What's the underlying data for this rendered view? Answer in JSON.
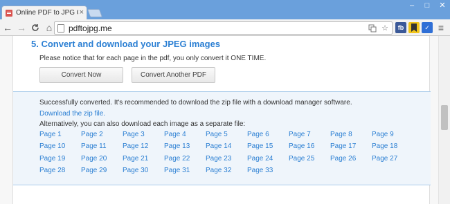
{
  "browser": {
    "tab_title": "Online PDF to JPG Conve",
    "url": "pdftojpg.me",
    "tab_close": "×",
    "window_controls": [
      "–",
      "□",
      "✕"
    ],
    "nav": {
      "back": "←",
      "forward": "→",
      "reload": "C",
      "home": "⌂"
    },
    "extensions": [
      {
        "name": "fb",
        "color": "#3b5998"
      },
      {
        "name": "bookmark",
        "color": "#e8b100"
      },
      {
        "name": "check",
        "color": "#2f6fd6"
      }
    ],
    "menu": "≡"
  },
  "section": {
    "title": "5. Convert and download your JPEG images",
    "notice": "Please notice that for each page in the pdf, you only convert it ONE TIME.",
    "buttons": {
      "convert_now": "Convert Now",
      "convert_another": "Convert Another PDF"
    }
  },
  "result": {
    "success": "Successfully converted. It's recommended to download the zip file with a download manager software.",
    "zip_link": "Download the zip file.",
    "alternative": "Alternatively, you can also download each image as a separate file:",
    "pages": [
      "Page 1",
      "Page 2",
      "Page 3",
      "Page 4",
      "Page 5",
      "Page 6",
      "Page 7",
      "Page 8",
      "Page 9",
      "Page 10",
      "Page 11",
      "Page 12",
      "Page 13",
      "Page 14",
      "Page 15",
      "Page 16",
      "Page 17",
      "Page 18",
      "Page 19",
      "Page 20",
      "Page 21",
      "Page 22",
      "Page 23",
      "Page 24",
      "Page 25",
      "Page 26",
      "Page 27",
      "Page 28",
      "Page 29",
      "Page 30",
      "Page 31",
      "Page 32",
      "Page 33"
    ]
  }
}
